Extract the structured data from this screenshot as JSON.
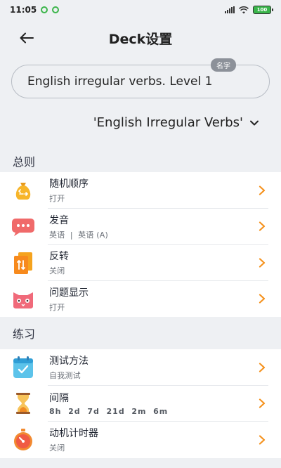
{
  "status": {
    "time": "11:05",
    "battery": "100"
  },
  "header": {
    "title": "Deck设置"
  },
  "name_field": {
    "badge": "名字",
    "value": "English irregular verbs. Level 1"
  },
  "deck_select": {
    "value": "'English Irregular Verbs'"
  },
  "sections": {
    "general": {
      "title": "总则",
      "items": [
        {
          "title": "随机顺序",
          "sub": "打开"
        },
        {
          "title": "发音",
          "sub_a": "英语",
          "sub_sep": "|",
          "sub_b": "英语 (A)"
        },
        {
          "title": "反转",
          "sub": "关闭"
        },
        {
          "title": "问题显示",
          "sub": "打开"
        }
      ]
    },
    "practice": {
      "title": "练习",
      "items": [
        {
          "title": "测试方法",
          "sub": "自我测试"
        },
        {
          "title": "间隔",
          "sub": "8h  2d  7d  21d  2m  6m"
        },
        {
          "title": "动机计时器",
          "sub": "关闭"
        }
      ]
    }
  },
  "colors": {
    "accent_orange": "#f5921e",
    "background": "#eef0f3"
  }
}
